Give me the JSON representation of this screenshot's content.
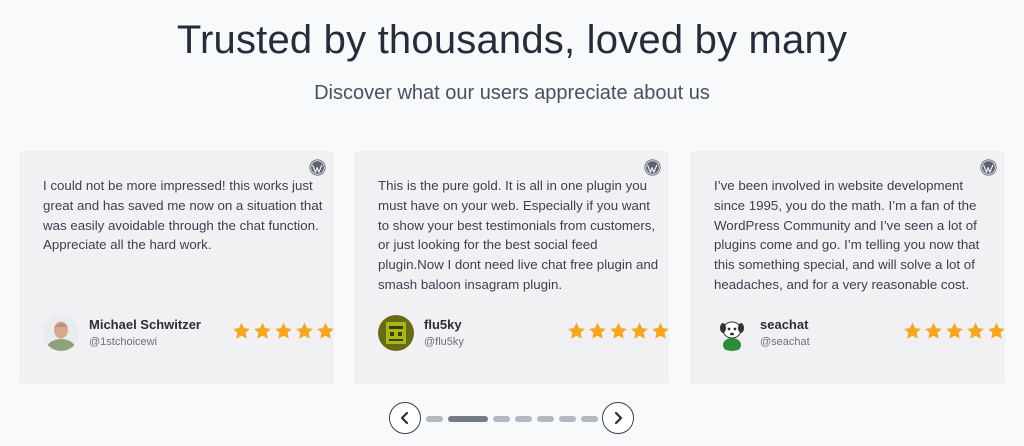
{
  "header": {
    "title": "Trusted by thousands, loved by many",
    "subtitle": "Discover what our users appreciate about us"
  },
  "testimonials": [
    {
      "quote": "I could not be more impressed! this works just great and has saved me now on a situation that was easily avoidable through the chat function. Appreciate all the hard work.",
      "name": "Michael Schwitzer",
      "handle": "@1stchoicewi",
      "rating": 5,
      "source_icon": "wordpress-icon"
    },
    {
      "quote": "This is the pure gold. It is all in one plugin you must have on your web. Especially if you want to show your best testimonials from customers, or just looking for the best social feed plugin.Now I dont need live chat free plugin and smash baloon insagram plugin.",
      "name": "flu5ky",
      "handle": "@flu5ky",
      "rating": 5,
      "source_icon": "wordpress-icon"
    },
    {
      "quote": "I’ve been involved in website development since 1995, you do the math. I’m a fan of the WordPress Community and I’ve seen a lot of plugins come and go. I’m telling you now that this something special, and will solve a lot of headaches, and for a very reasonable cost.",
      "name": "seachat",
      "handle": "@seachat",
      "rating": 5,
      "source_icon": "wordpress-icon"
    }
  ],
  "carousel": {
    "page_count": 7,
    "active_page": 2,
    "prev_icon": "chevron-left-icon",
    "next_icon": "chevron-right-icon"
  },
  "colors": {
    "background": "#f8f9fb",
    "card": "#f1f1f3",
    "star": "#f5a623",
    "dot": "#b5b8c0",
    "dot_active": "#757a88"
  }
}
